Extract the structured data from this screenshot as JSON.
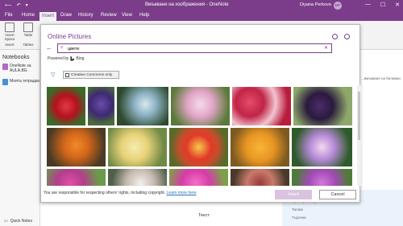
{
  "titlebar": {
    "title": "Вмъкване на изображения  -  OneNote",
    "user": "Diyana Perkova",
    "initials": "DP",
    "min": "—",
    "max": "☐",
    "close": "✕"
  },
  "menu": {
    "tabs": [
      "File",
      "Home",
      "Insert",
      "Draw",
      "History",
      "Review",
      "View",
      "Help"
    ]
  },
  "ribbon": {
    "insert_space": "Insert\nSpace",
    "insert_group": "Insert",
    "table": "Table",
    "tables_group": "Tables"
  },
  "notebooks": {
    "header": "Notebooks",
    "items": [
      {
        "label": "OneNote за AULA.BG",
        "color": "#b06ac0"
      },
      {
        "label": "Моята тетрадка",
        "color": "#4a8fd8"
      }
    ],
    "quick_notes": "Quick Notes"
  },
  "pagelist": {
    "items": [
      "...вмъкване на бележки",
      "Примерен видеозапис",
      "Таговe",
      "Търсене"
    ]
  },
  "page": {
    "bottom_text": "Текст"
  },
  "dialog": {
    "title": "Online Pictures",
    "search_value": "цвете",
    "powered_by": "Powered by",
    "bing": "Bing",
    "creative_commons": "Creative Commons only",
    "footer_text": "You are responsible for respecting others' rights, including copyright.",
    "learn_more": "Learn more here",
    "insert_label": "Insert",
    "cancel_label": "Cancel"
  }
}
